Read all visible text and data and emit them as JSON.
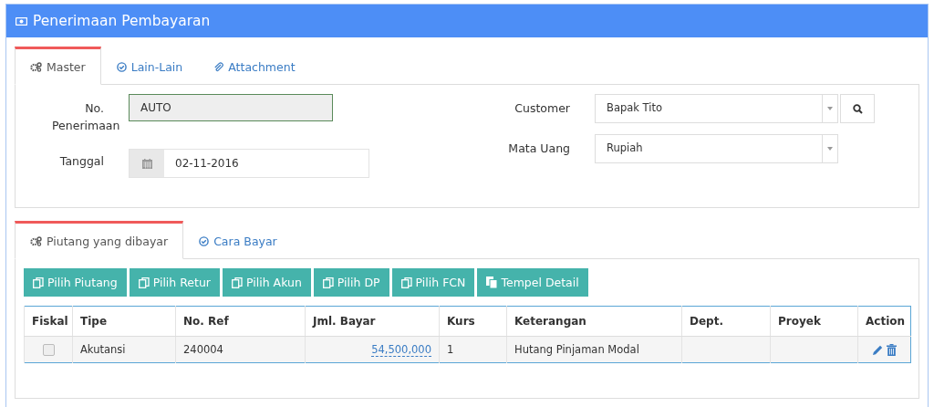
{
  "window": {
    "title": "Penerimaan Pembayaran"
  },
  "master_tabs": [
    {
      "label": "Master",
      "selected": true
    },
    {
      "label": "Lain-Lain",
      "selected": false
    },
    {
      "label": "Attachment",
      "selected": false
    }
  ],
  "master": {
    "left": [
      {
        "kind": "readonly",
        "label": "No. Penerimaan",
        "value": "AUTO"
      },
      {
        "kind": "date",
        "label": "Tanggal",
        "value": "02-11-2016"
      }
    ],
    "right": [
      {
        "kind": "select_search",
        "label": "Customer",
        "value": "Bapak Tito"
      },
      {
        "kind": "select",
        "label": "Mata Uang",
        "value": "Rupiah"
      }
    ]
  },
  "detail_tabs": [
    {
      "label": "Piutang yang dibayar",
      "selected": true
    },
    {
      "label": "Cara Bayar",
      "selected": false
    }
  ],
  "buttons": [
    "Pilih Piutang",
    "Pilih Retur",
    "Pilih Akun",
    "Pilih DP",
    "Pilih FCN",
    "Tempel Detail"
  ],
  "table": {
    "columns": [
      "Fiskal",
      "Tipe",
      "No. Ref",
      "Jml. Bayar",
      "Kurs",
      "Keterangan",
      "Dept.",
      "Proyek",
      "Action"
    ],
    "rows": [
      {
        "fiskal": false,
        "tipe": "Akutansi",
        "no_ref": "240004",
        "jml_bayar": "54,500,000",
        "kurs": "1",
        "keterangan": "Hutang Pinjaman Modal"
      }
    ]
  }
}
